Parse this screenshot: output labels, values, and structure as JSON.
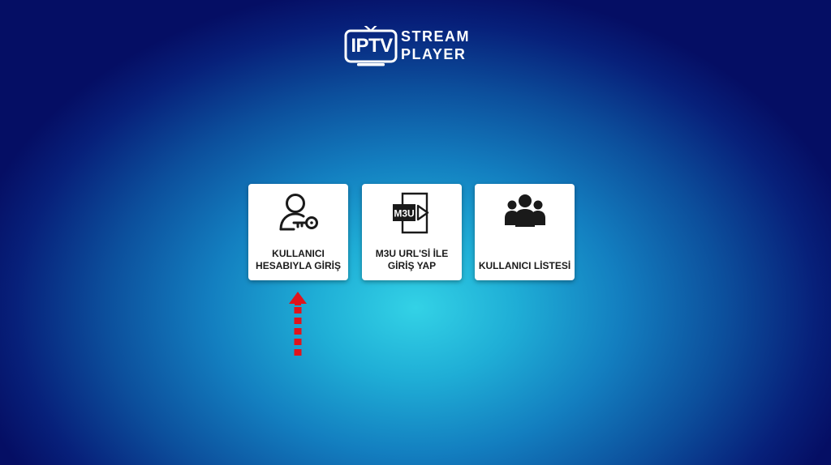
{
  "logo": {
    "badge_text": "IPTV",
    "word_1": "STREAM",
    "word_2": "PLAYER",
    "icon": "tv-antenna-icon"
  },
  "menu": {
    "items": [
      {
        "id": "account-login",
        "icon": "user-key-icon",
        "label_line_1": "KULLANICI",
        "label_line_2": "HESABIYLA GİRİŞ"
      },
      {
        "id": "m3u-login",
        "icon": "m3u-file-icon",
        "icon_text": "M3U",
        "label_line_1": "M3U URL'Sİ İLE",
        "label_line_2": "GİRİŞ YAP"
      },
      {
        "id": "user-list",
        "icon": "users-group-icon",
        "label_line_1": "KULLANICI LİSTESİ"
      }
    ]
  },
  "annotation": {
    "arrow_icon": "dashed-up-arrow-icon",
    "color": "#e0141c"
  }
}
